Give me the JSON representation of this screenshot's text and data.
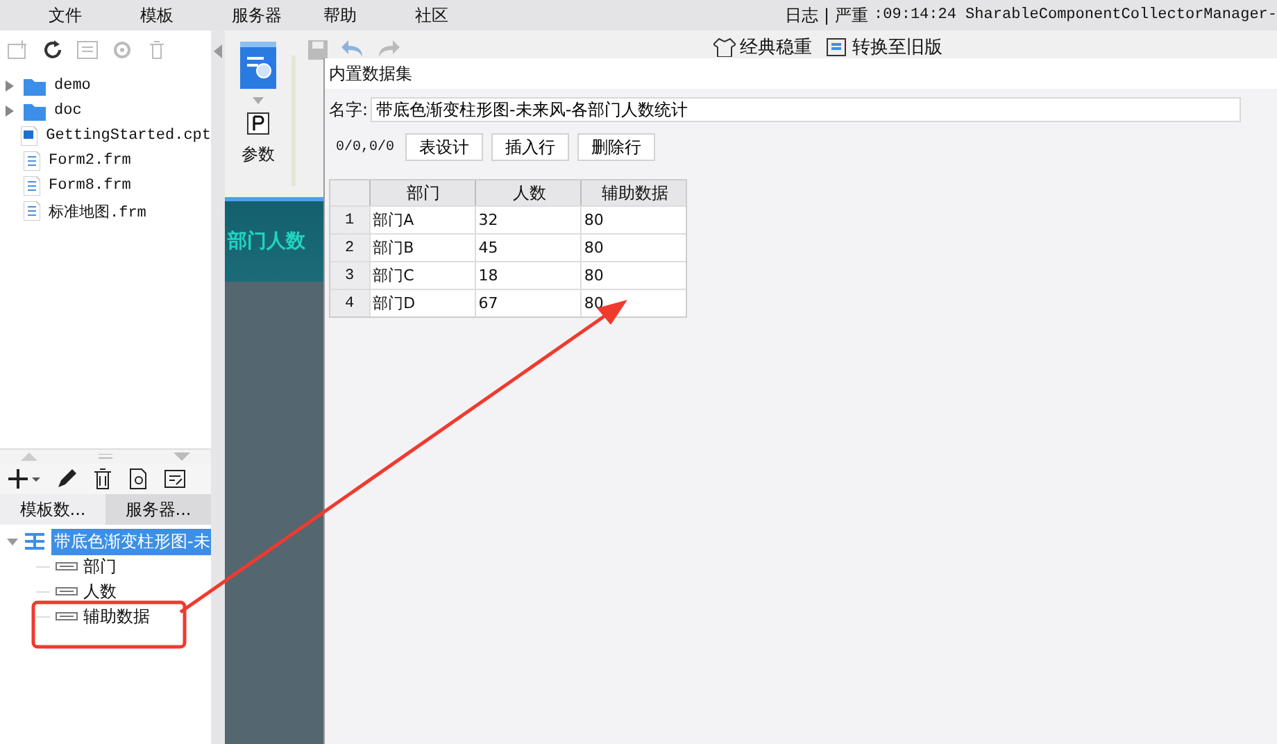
{
  "menu": [
    {
      "label": "文件"
    },
    {
      "label": "模板"
    },
    {
      "label": "服务器"
    },
    {
      "label": "帮助"
    },
    {
      "label": "社区"
    }
  ],
  "status": {
    "log": "日志",
    "separator": "|",
    "level": "严重",
    "message": ":09:14:24 SharableComponentCollectorManager-"
  },
  "file_tree": [
    {
      "name": "demo",
      "kind": "folder",
      "expanded": false
    },
    {
      "name": "doc",
      "kind": "folder",
      "expanded": false
    },
    {
      "name": "GettingStarted.cpt",
      "kind": "cpt"
    },
    {
      "name": "Form2.frm",
      "kind": "frm"
    },
    {
      "name": "Form8.frm",
      "kind": "frm"
    },
    {
      "name": "标准地图.frm",
      "kind": "frm"
    }
  ],
  "dataset_panel": {
    "tabs": [
      {
        "label": "模板数...",
        "selected": true
      },
      {
        "label": "服务器...",
        "selected": false
      }
    ],
    "tree": [
      {
        "label": "带底色渐变柱形图-未",
        "selected": true,
        "expanded": true,
        "children": [
          {
            "label": "部门"
          },
          {
            "label": "人数"
          },
          {
            "label": "辅助数据"
          }
        ]
      }
    ]
  },
  "toolbar": {
    "param_label": "参数",
    "style_buttons": [
      {
        "label": "经典稳重"
      },
      {
        "label": "转换至旧版"
      }
    ]
  },
  "canvas": {
    "banner": "部门人数"
  },
  "dialog": {
    "title": "内置数据集",
    "name_label": "名字:",
    "name_value": "带底色渐变柱形图-未来风-各部门人数统计",
    "position": "0/0,0/0",
    "buttons": [
      {
        "label": "表设计"
      },
      {
        "label": "插入行"
      },
      {
        "label": "删除行"
      }
    ],
    "columns": [
      "部门",
      "人数",
      "辅助数据"
    ],
    "rows": [
      {
        "number": "1",
        "cells": [
          "部门A",
          "32",
          "80"
        ]
      },
      {
        "number": "2",
        "cells": [
          "部门B",
          "45",
          "80"
        ]
      },
      {
        "number": "3",
        "cells": [
          "部门C",
          "18",
          "80"
        ]
      },
      {
        "number": "4",
        "cells": [
          "部门D",
          "67",
          "80"
        ]
      }
    ]
  }
}
